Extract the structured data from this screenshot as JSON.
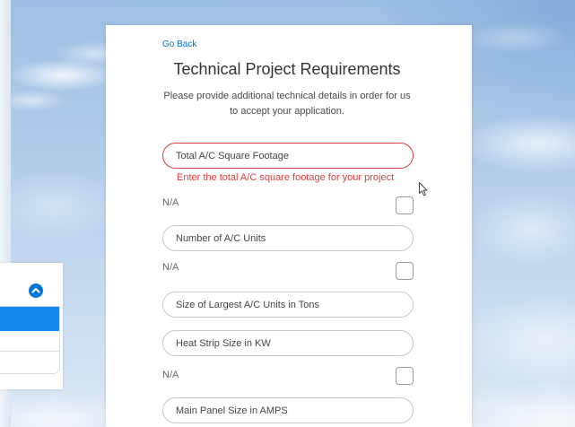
{
  "header": {
    "go_back": "Go Back",
    "title": "Technical Project Requirements",
    "description": {
      "line1": "Please provide additional technical details in order for us",
      "line2": "to accept your application."
    }
  },
  "form": {
    "fields": [
      {
        "placeholder": "Total A/C Square Footage",
        "value": "",
        "error": "Enter the total A/C square footage for your project"
      },
      {
        "placeholder": "Number of A/C Units",
        "value": ""
      },
      {
        "placeholder": "Size of Largest A/C Units in Tons",
        "value": ""
      },
      {
        "placeholder": "Heat Strip Size in KW",
        "value": ""
      },
      {
        "placeholder": "Main Panel Size in AMPS",
        "value": ""
      }
    ],
    "na_options": [
      {
        "label": "N/A",
        "checked": false
      },
      {
        "label": "N/A",
        "checked": false
      },
      {
        "label": "N/A",
        "checked": false
      }
    ]
  },
  "icons": {
    "side_toggle": "chevron-up-icon",
    "pointer": "mouse-cursor-icon"
  },
  "colors": {
    "link": "#0070d2",
    "error": "#d9403f",
    "selected_band": "#1589ee",
    "toggle": "#0176d3"
  }
}
